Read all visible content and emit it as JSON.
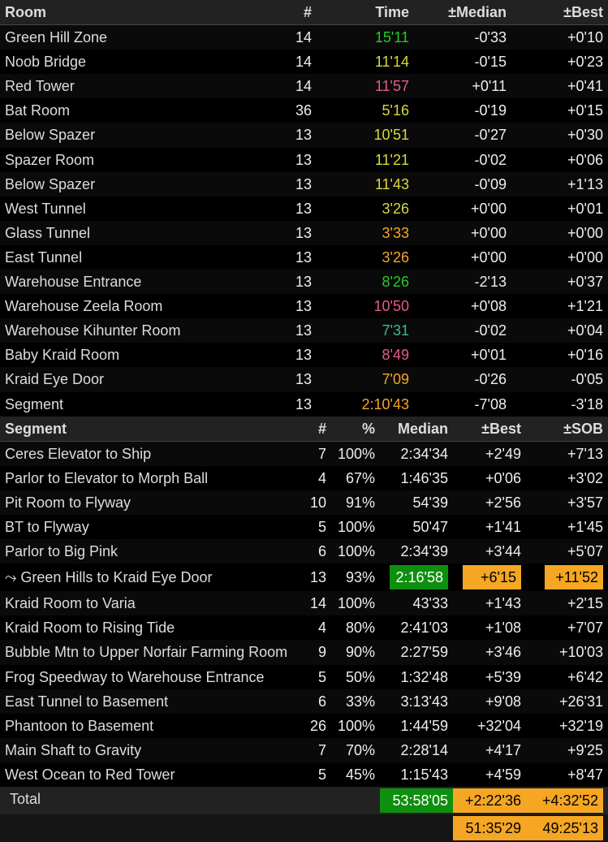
{
  "roomTable": {
    "headers": {
      "room": "Room",
      "num": "#",
      "time": "Time",
      "median": "±Median",
      "best": "±Best"
    },
    "rows": [
      {
        "room": "Green Hill Zone",
        "num": 14,
        "time": "15'11",
        "tcolor": "c-green",
        "median": "-0'33",
        "best": "+0'10"
      },
      {
        "room": "Noob Bridge",
        "num": 14,
        "time": "11'14",
        "tcolor": "c-yellow",
        "median": "-0'15",
        "best": "+0'23"
      },
      {
        "room": "Red Tower",
        "num": 14,
        "time": "11'57",
        "tcolor": "c-pink",
        "median": "+0'11",
        "best": "+0'41"
      },
      {
        "room": "Bat Room",
        "num": 36,
        "time": "5'16",
        "tcolor": "c-yellow",
        "median": "-0'19",
        "best": "+0'15"
      },
      {
        "room": "Below Spazer",
        "num": 13,
        "time": "10'51",
        "tcolor": "c-yellow",
        "median": "-0'27",
        "best": "+0'30"
      },
      {
        "room": "Spazer Room",
        "num": 13,
        "time": "11'21",
        "tcolor": "c-yellow",
        "median": "-0'02",
        "best": "+0'06"
      },
      {
        "room": "Below Spazer",
        "num": 13,
        "time": "11'43",
        "tcolor": "c-yellow",
        "median": "-0'09",
        "best": "+1'13"
      },
      {
        "room": "West Tunnel",
        "num": 13,
        "time": "3'26",
        "tcolor": "c-yellow",
        "median": "+0'00",
        "best": "+0'01"
      },
      {
        "room": "Glass Tunnel",
        "num": 13,
        "time": "3'33",
        "tcolor": "c-orange",
        "median": "+0'00",
        "best": "+0'00"
      },
      {
        "room": "East Tunnel",
        "num": 13,
        "time": "3'26",
        "tcolor": "c-orange",
        "median": "+0'00",
        "best": "+0'00"
      },
      {
        "room": "Warehouse Entrance",
        "num": 13,
        "time": "8'26",
        "tcolor": "c-green",
        "median": "-2'13",
        "best": "+0'37"
      },
      {
        "room": "Warehouse Zeela Room",
        "num": 13,
        "time": "10'50",
        "tcolor": "c-pink",
        "median": "+0'08",
        "best": "+1'21"
      },
      {
        "room": "Warehouse Kihunter Room",
        "num": 13,
        "time": "7'31",
        "tcolor": "c-teal",
        "median": "-0'02",
        "best": "+0'04"
      },
      {
        "room": "Baby Kraid Room",
        "num": 13,
        "time": "8'49",
        "tcolor": "c-pink",
        "median": "+0'01",
        "best": "+0'16"
      },
      {
        "room": "Kraid Eye Door",
        "num": 13,
        "time": "7'09",
        "tcolor": "c-orange",
        "median": "-0'26",
        "best": "-0'05"
      },
      {
        "room": "Segment",
        "num": 13,
        "time": "2:10'43",
        "tcolor": "c-orange",
        "median": "-7'08",
        "best": "-3'18"
      }
    ]
  },
  "segTable": {
    "headers": {
      "segment": "Segment",
      "num": "#",
      "pct": "%",
      "median": "Median",
      "best": "±Best",
      "sob": "±SOB"
    },
    "rows": [
      {
        "seg": "Ceres Elevator to Ship",
        "num": 7,
        "pct": "100%",
        "median": "2:34'34",
        "best": "+2'49",
        "sob": "+7'13"
      },
      {
        "seg": "Parlor to Elevator to Morph Ball",
        "num": 4,
        "pct": "67%",
        "median": "1:46'35",
        "best": "+0'06",
        "sob": "+3'02"
      },
      {
        "seg": "Pit Room to Flyway",
        "num": 10,
        "pct": "91%",
        "median": "54'39",
        "best": "+2'56",
        "sob": "+3'57"
      },
      {
        "seg": "BT to Flyway",
        "num": 5,
        "pct": "100%",
        "median": "50'47",
        "best": "+1'41",
        "sob": "+1'45"
      },
      {
        "seg": "Parlor to Big Pink",
        "num": 6,
        "pct": "100%",
        "median": "2:34'39",
        "best": "+3'44",
        "sob": "+5'07"
      },
      {
        "seg": "⤳ Green Hills to Kraid Eye Door",
        "num": 13,
        "pct": "93%",
        "median": "2:16'58",
        "best": "+6'15",
        "sob": "+11'52",
        "highlight": true
      },
      {
        "seg": "Kraid Room to Varia",
        "num": 14,
        "pct": "100%",
        "median": "43'33",
        "best": "+1'43",
        "sob": "+2'15"
      },
      {
        "seg": "Kraid Room to Rising Tide",
        "num": 4,
        "pct": "80%",
        "median": "2:41'03",
        "best": "+1'08",
        "sob": "+7'07"
      },
      {
        "seg": "Bubble Mtn to Upper Norfair Farming Room",
        "num": 9,
        "pct": "90%",
        "median": "2:27'59",
        "best": "+3'46",
        "sob": "+10'03"
      },
      {
        "seg": "Frog Speedway to Warehouse Entrance",
        "num": 5,
        "pct": "50%",
        "median": "1:32'48",
        "best": "+5'39",
        "sob": "+6'42"
      },
      {
        "seg": "East Tunnel to Basement",
        "num": 6,
        "pct": "33%",
        "median": "3:13'43",
        "best": "+9'08",
        "sob": "+26'31"
      },
      {
        "seg": "Phantoon to Basement",
        "num": 26,
        "pct": "100%",
        "median": "1:44'59",
        "best": "+32'04",
        "sob": "+32'19"
      },
      {
        "seg": "Main Shaft to Gravity",
        "num": 7,
        "pct": "70%",
        "median": "2:28'14",
        "best": "+4'17",
        "sob": "+9'25"
      },
      {
        "seg": "West Ocean to Red Tower",
        "num": 5,
        "pct": "45%",
        "median": "1:15'43",
        "best": "+4'59",
        "sob": "+8'47"
      }
    ]
  },
  "totals": {
    "label": "Total",
    "median": "53:58'05",
    "best": "+2:22'36",
    "sob": "+4:32'52",
    "best2": "51:35'29",
    "sob2": "49:25'13"
  }
}
